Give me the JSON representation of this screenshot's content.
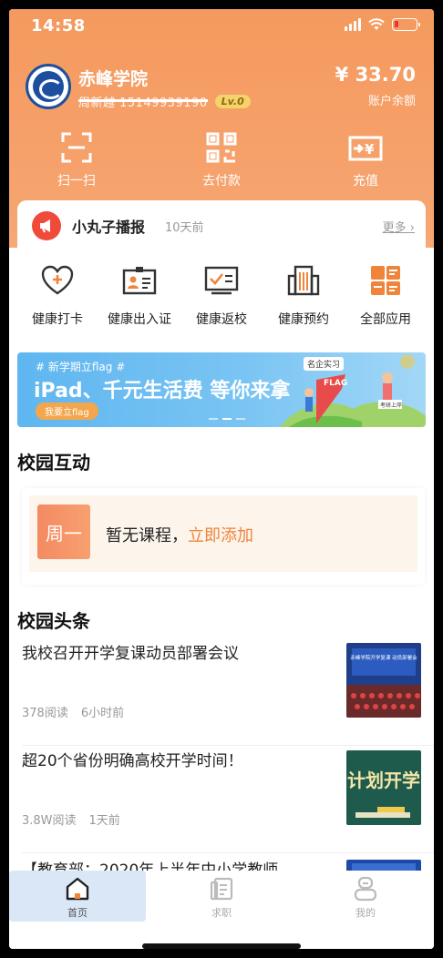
{
  "status_bar": {
    "time": "14:58"
  },
  "account": {
    "school_name": "赤峰学院",
    "phone": "周新越 15149939190",
    "level": "Lv.0",
    "balance": "¥ 33.70",
    "balance_label": "账户余额"
  },
  "quick_actions": [
    {
      "label": "扫一扫",
      "icon": "scan-icon"
    },
    {
      "label": "去付款",
      "icon": "qr-code-icon"
    },
    {
      "label": "充值",
      "icon": "recharge-icon"
    }
  ],
  "notice": {
    "title": "小丸子播报",
    "time": "10天前",
    "more": "更多"
  },
  "apps": [
    {
      "label": "健康打卡",
      "icon": "heart-plus-icon"
    },
    {
      "label": "健康出入证",
      "icon": "id-card-icon"
    },
    {
      "label": "健康返校",
      "icon": "checklist-icon"
    },
    {
      "label": "健康预约",
      "icon": "building-icon"
    },
    {
      "label": "全部应用",
      "icon": "grid-apps-icon"
    }
  ],
  "banner": {
    "tag": "# 新学期立flag #",
    "headline": "iPad、千元生活费 等你来拿",
    "button": "我要立flag",
    "chip": "名企实习",
    "flag": "FLAG",
    "sign": "考研上岸"
  },
  "campus_interaction": {
    "title": "校园互动",
    "day": "周一",
    "empty_text": "暂无课程，",
    "add_link": "立即添加"
  },
  "headlines": {
    "title": "校园头条",
    "items": [
      {
        "title": "我校召开开学复课动员部署会议",
        "reads": "378阅读",
        "time": "6小时前",
        "thumb_caption": "赤峰学院开学复课 动员部署会"
      },
      {
        "title": "超20个省份明确高校开学时间！",
        "reads": "3.8W阅读",
        "time": "1天前",
        "thumb_caption": "计划开学"
      },
      {
        "title": "【教育部：2020年上半年中小学教师",
        "reads": "",
        "time": "",
        "thumb_caption": ""
      }
    ]
  },
  "tabbar": [
    {
      "label": "首页",
      "icon": "home-icon",
      "active": true
    },
    {
      "label": "求职",
      "icon": "resume-icon",
      "active": false
    },
    {
      "label": "我的",
      "icon": "profile-icon",
      "active": false
    }
  ],
  "colors": {
    "accent": "#f49a5e",
    "link": "#f0843a",
    "notice_red": "#f04a3b",
    "tab_active_bg": "#d9e7f7"
  }
}
